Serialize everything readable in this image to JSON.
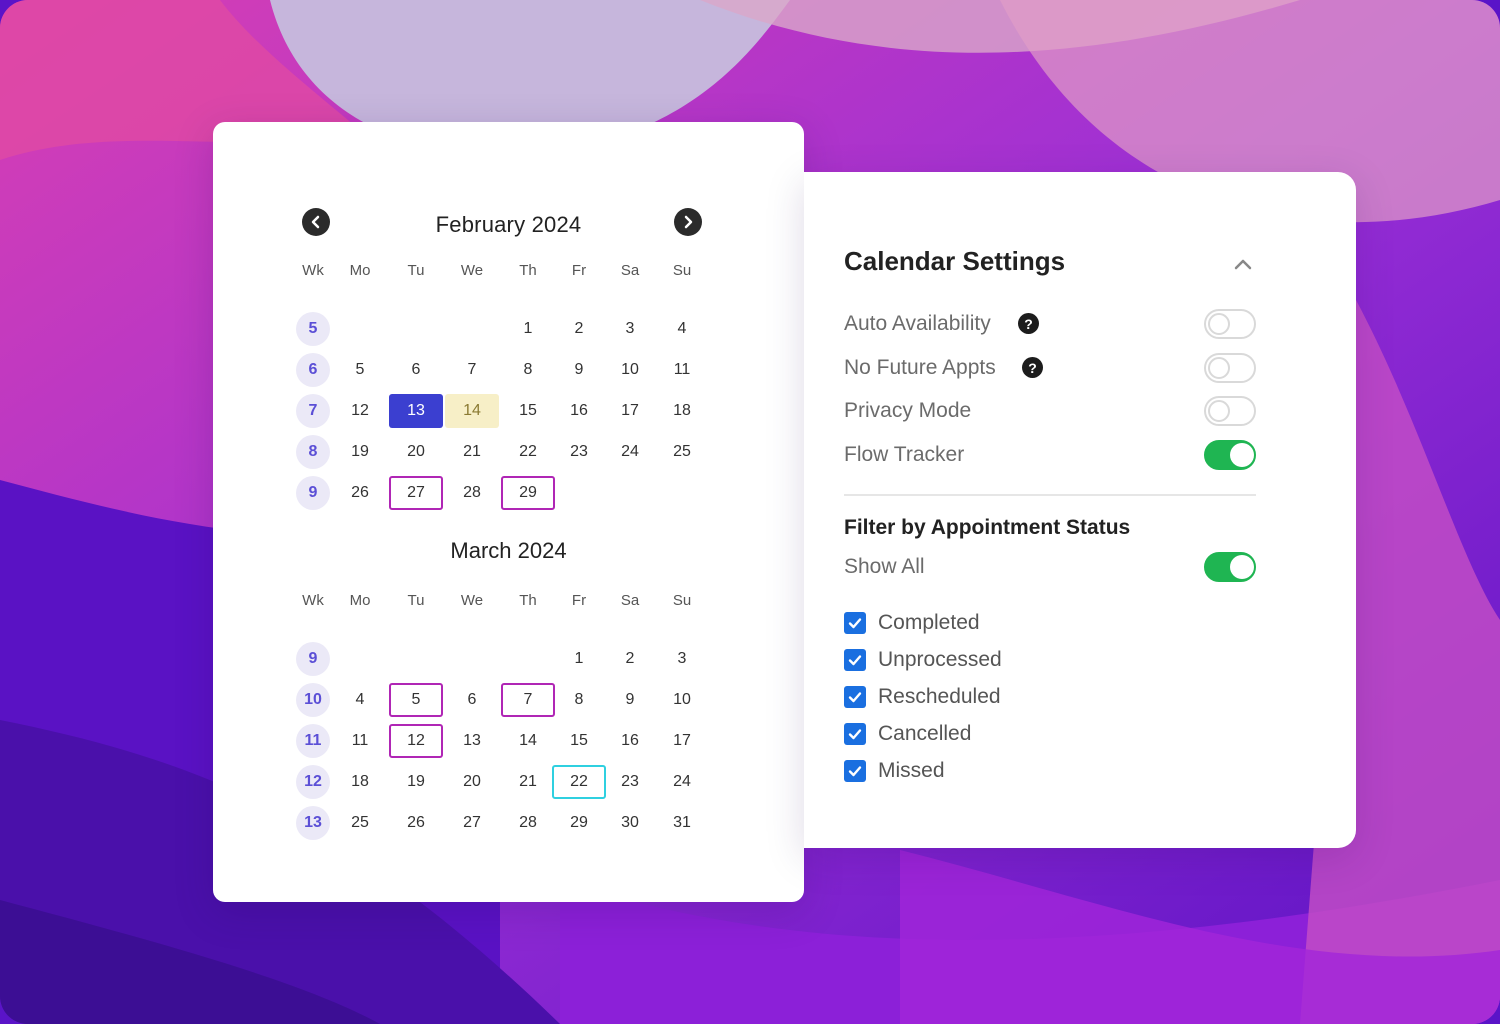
{
  "calendar": {
    "prev_label": "previous month",
    "next_label": "next month",
    "weekday_headers": [
      "Wk",
      "Mo",
      "Tu",
      "We",
      "Th",
      "Fr",
      "Sa",
      "Su"
    ],
    "months": [
      {
        "title": "February 2024",
        "weeks": [
          {
            "wk": "5",
            "days": [
              "",
              "",
              "",
              "1",
              "2",
              "3",
              "4"
            ]
          },
          {
            "wk": "6",
            "days": [
              "5",
              "6",
              "7",
              "8",
              "9",
              "10",
              "11"
            ]
          },
          {
            "wk": "7",
            "days": [
              "12",
              "13",
              "14",
              "15",
              "16",
              "17",
              "18"
            ]
          },
          {
            "wk": "8",
            "days": [
              "19",
              "20",
              "21",
              "22",
              "23",
              "24",
              "25"
            ]
          },
          {
            "wk": "9",
            "days": [
              "26",
              "27",
              "28",
              "29",
              "",
              "",
              ""
            ]
          }
        ],
        "selected": [
          "13"
        ],
        "today": [
          "14"
        ],
        "appointments": [
          "27",
          "29"
        ],
        "outlined": []
      },
      {
        "title": "March 2024",
        "weeks": [
          {
            "wk": "9",
            "days": [
              "",
              "",
              "",
              "",
              "1",
              "2",
              "3"
            ]
          },
          {
            "wk": "10",
            "days": [
              "4",
              "5",
              "6",
              "7",
              "8",
              "9",
              "10"
            ]
          },
          {
            "wk": "11",
            "days": [
              "11",
              "12",
              "13",
              "14",
              "15",
              "16",
              "17"
            ]
          },
          {
            "wk": "12",
            "days": [
              "18",
              "19",
              "20",
              "21",
              "22",
              "23",
              "24"
            ]
          },
          {
            "wk": "13",
            "days": [
              "25",
              "26",
              "27",
              "28",
              "29",
              "30",
              "31"
            ]
          }
        ],
        "selected": [],
        "today": [],
        "appointments": [
          "5",
          "7",
          "12"
        ],
        "outlined": [
          "22"
        ]
      }
    ]
  },
  "settings": {
    "title": "Calendar Settings",
    "toggles": [
      {
        "label": "Auto Availability",
        "help": true,
        "on": false
      },
      {
        "label": "No Future Appts",
        "help": true,
        "on": false
      },
      {
        "label": "Privacy Mode",
        "help": false,
        "on": false
      },
      {
        "label": "Flow Tracker",
        "help": false,
        "on": true
      }
    ],
    "help_glyph": "?",
    "filter": {
      "title": "Filter by Appointment Status",
      "show_all_label": "Show All",
      "show_all_on": true,
      "statuses": [
        {
          "label": "Completed",
          "checked": true
        },
        {
          "label": "Unprocessed",
          "checked": true
        },
        {
          "label": "Rescheduled",
          "checked": true
        },
        {
          "label": "Cancelled",
          "checked": true
        },
        {
          "label": "Missed",
          "checked": true
        }
      ]
    }
  },
  "colors": {
    "selected_day": "#3b3fd0",
    "today_day": "#f7efc7",
    "appointment_outline": "#b026b5",
    "teal_outline": "#2fd0e0",
    "toggle_on": "#1fb552",
    "checkbox": "#1a6fe0"
  }
}
